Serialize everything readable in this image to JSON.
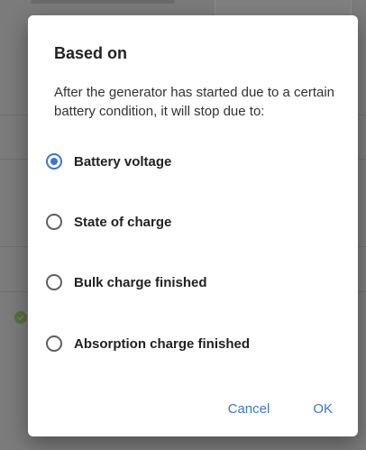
{
  "dialog": {
    "title": "Based on",
    "message": "After the generator has started due to a certain battery condition, it will stop due to:",
    "options": [
      {
        "label": "Battery voltage",
        "selected": true
      },
      {
        "label": "State of charge",
        "selected": false
      },
      {
        "label": "Bulk charge finished",
        "selected": false
      },
      {
        "label": "Absorption charge finished",
        "selected": false
      }
    ],
    "cancel_label": "Cancel",
    "ok_label": "OK"
  },
  "colors": {
    "accent": "#3d78c9",
    "scrim": "#7b7b7b",
    "status_ok": "#55703c"
  },
  "icons": {
    "background_status": "check-circle-icon"
  }
}
